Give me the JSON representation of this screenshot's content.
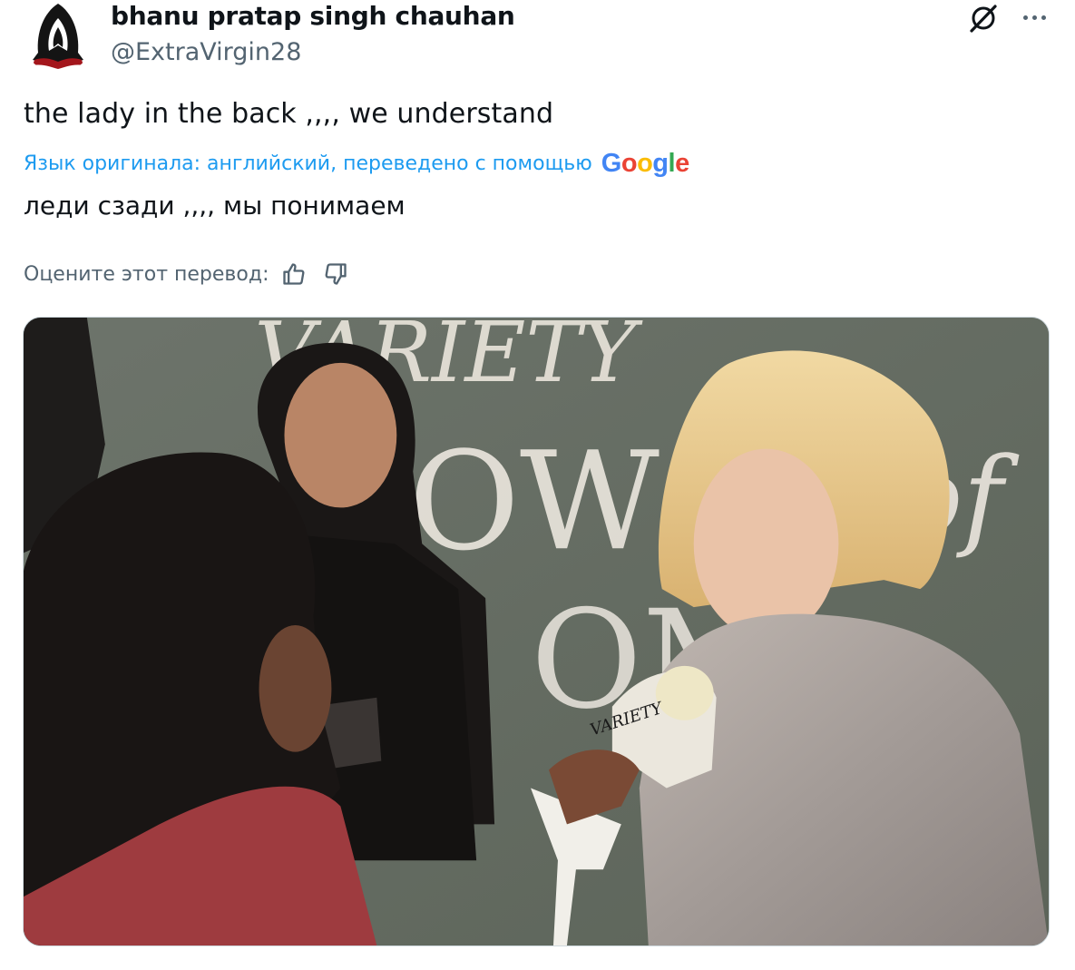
{
  "tweet": {
    "author": {
      "name": "bhanu pratap singh chauhan",
      "handle": "@ExtraVirgin28"
    },
    "text": "the lady in the back ,,,, we understand",
    "translation": {
      "note": "Язык оригинала: английский, переведено с помощью",
      "provider_letters": [
        {
          "ch": "G",
          "color": "#4285f4"
        },
        {
          "ch": "o",
          "color": "#ea4335"
        },
        {
          "ch": "o",
          "color": "#fbbc05"
        },
        {
          "ch": "g",
          "color": "#4285f4"
        },
        {
          "ch": "l",
          "color": "#34a853"
        },
        {
          "ch": "e",
          "color": "#ea4335"
        }
      ],
      "text": "леди сзади ,,,, мы понимаем",
      "rate_label": "Оцените этот перевод:"
    },
    "media": {
      "backdrop_text_top": "VARIETY",
      "backdrop_text_mid": "OW",
      "backdrop_text_of": "of",
      "backdrop_text_low": "OM",
      "mic_logo": "VARIETY"
    }
  },
  "colors": {
    "text_primary": "#0f1419",
    "text_secondary": "#536471",
    "link": "#1d9bf0",
    "border": "#cfd9de"
  },
  "icons": {
    "grok": "grok-icon",
    "more": "more-icon",
    "like": "thumbs-up-icon",
    "dislike": "thumbs-down-icon"
  }
}
